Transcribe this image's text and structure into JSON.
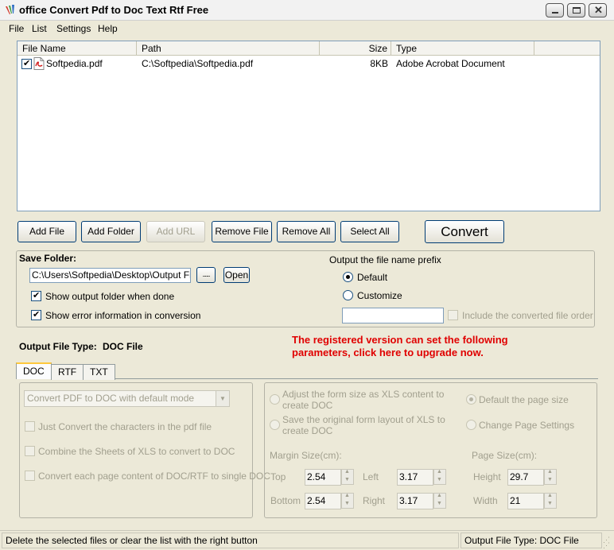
{
  "window": {
    "title": "office Convert Pdf to Doc Text Rtf Free"
  },
  "menu": [
    "File",
    "List",
    "Settings",
    "Help"
  ],
  "file_list": {
    "columns": [
      "File Name",
      "Path",
      "Size",
      "Type"
    ],
    "rows": [
      {
        "name": "Softpedia.pdf",
        "path": "C:\\Softpedia\\Softpedia.pdf",
        "size": "8KB",
        "type": "Adobe Acrobat Document",
        "checked": true
      }
    ]
  },
  "toolbar": {
    "add_file": "Add File",
    "add_folder": "Add Folder",
    "add_url": "Add URL",
    "remove_file": "Remove File",
    "remove_all": "Remove All",
    "select_all": "Select All",
    "convert": "Convert"
  },
  "save_folder": {
    "label": "Save Folder:",
    "path": "C:\\Users\\Softpedia\\Desktop\\Output Files",
    "browse": "......",
    "open": "Open",
    "show_output": "Show output folder when done",
    "show_error": "Show error information in conversion"
  },
  "prefix": {
    "label": "Output the file name prefix",
    "default": "Default",
    "customize": "Customize",
    "include_order": "Include the converted file order"
  },
  "output_type": {
    "label": "Output File Type:",
    "value": "DOC File"
  },
  "upgrade": {
    "line1": "The registered version can set the following",
    "line2": "parameters, click here to upgrade now.",
    "color": "#e00000"
  },
  "tabs": [
    "DOC",
    "RTF",
    "TXT"
  ],
  "doc_options": {
    "mode": "Convert PDF to DOC with default mode",
    "opt1": "Just Convert the characters in the pdf file",
    "opt2": "Combine the Sheets of XLS to convert to DOC",
    "opt3": "Convert each page content of DOC/RTF to single DOC"
  },
  "right_options": {
    "adjust_line1": "Adjust the form size as XLS content to",
    "adjust_line2": "create DOC",
    "save_line1": "Save the original form layout of XLS to",
    "save_line2": "create DOC",
    "default_page": "Default the page size",
    "change_page": "Change Page Settings",
    "margin_label": "Margin Size(cm):",
    "page_label": "Page Size(cm):",
    "top_label": "Top",
    "top": "2.54",
    "left_label": "Left",
    "left": "3.17",
    "bottom_label": "Bottom",
    "bottom": "2.54",
    "right_label": "Right",
    "right": "3.17",
    "height_label": "Height",
    "height": "29.7",
    "width_label": "Width",
    "width": "21"
  },
  "status": {
    "left": "Delete the selected files or clear the list with the right button",
    "right": "Output File Type:  DOC File"
  },
  "icons": {
    "app": "app-logo-icon",
    "pdf": "pdf-file-icon",
    "window_controls": [
      "minimize-icon",
      "maximize-icon",
      "close-icon"
    ]
  }
}
